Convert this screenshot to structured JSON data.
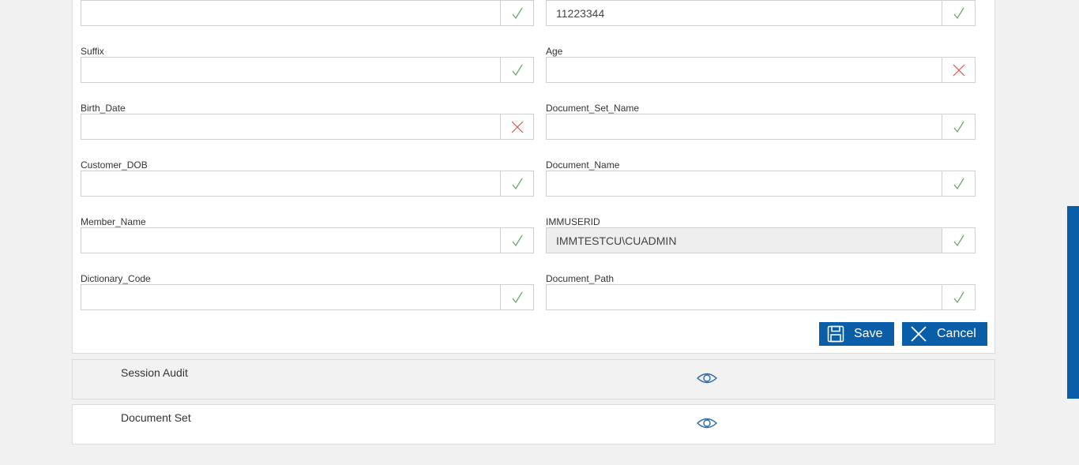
{
  "form": {
    "left_fields": [
      {
        "name": "first-name-field",
        "label": "",
        "value": "",
        "status": "valid"
      },
      {
        "name": "suffix-field",
        "label": "Suffix",
        "value": "",
        "status": "valid"
      },
      {
        "name": "birth-date-field",
        "label": "Birth_Date",
        "value": "",
        "status": "invalid"
      },
      {
        "name": "customer-dob-field",
        "label": "Customer_DOB",
        "value": "",
        "status": "valid"
      },
      {
        "name": "member-name-field",
        "label": "Member_Name",
        "value": "",
        "status": "valid"
      },
      {
        "name": "dictionary-code-field",
        "label": "Dictionary_Code",
        "value": "",
        "status": "valid"
      }
    ],
    "right_fields": [
      {
        "name": "member-id-field",
        "label": "",
        "value": "11223344",
        "status": "valid"
      },
      {
        "name": "age-field",
        "label": "Age",
        "value": "",
        "status": "invalid"
      },
      {
        "name": "document-set-name-field",
        "label": "Document_Set_Name",
        "value": "",
        "status": "valid"
      },
      {
        "name": "document-name-field",
        "label": "Document_Name",
        "value": "",
        "status": "valid"
      },
      {
        "name": "immuserid-field",
        "label": "IMMUSERID",
        "value": "IMMTESTCU\\CUADMIN",
        "status": "valid",
        "readonly": true
      },
      {
        "name": "document-path-field",
        "label": "Document_Path",
        "value": "",
        "status": "valid"
      }
    ],
    "save_label": "Save",
    "cancel_label": "Cancel"
  },
  "sections": [
    {
      "title": "Session Audit",
      "icon": "eye-icon"
    },
    {
      "title": "Document Set",
      "icon": "eye-icon"
    }
  ],
  "colors": {
    "accent": "#0a5ea8",
    "valid": "#5fa35f",
    "invalid": "#d9534f",
    "section_alt_bg": "#f2f2f2"
  }
}
